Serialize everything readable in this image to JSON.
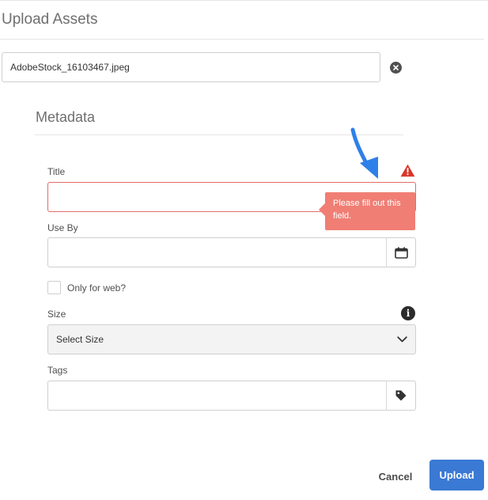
{
  "dialog": {
    "title": "Upload Assets"
  },
  "file": {
    "name": "AdobeStock_16103467.jpeg"
  },
  "metadata": {
    "section_title": "Metadata",
    "fields": {
      "title": {
        "label": "Title",
        "value": "",
        "error_message": "Please fill out this field."
      },
      "use_by": {
        "label": "Use By",
        "value": ""
      },
      "only_web": {
        "label": "Only for web?",
        "checked": false
      },
      "size": {
        "label": "Size",
        "selected": "Select Size"
      },
      "tags": {
        "label": "Tags",
        "value": ""
      }
    }
  },
  "actions": {
    "cancel_label": "Cancel",
    "upload_label": "Upload"
  },
  "colors": {
    "error": "#e46a6a",
    "tooltip": "#f07e74",
    "warning": "#d9362b",
    "primary": "#3a79d4",
    "annotation": "#2f80e8"
  },
  "icons": {
    "remove_file": "close-circle-icon",
    "warning": "warning-triangle-icon",
    "calendar": "calendar-icon",
    "info": "info-icon",
    "dropdown": "chevron-down-icon",
    "tags": "tag-icon",
    "annotation": "blue-arrow-annotation"
  }
}
